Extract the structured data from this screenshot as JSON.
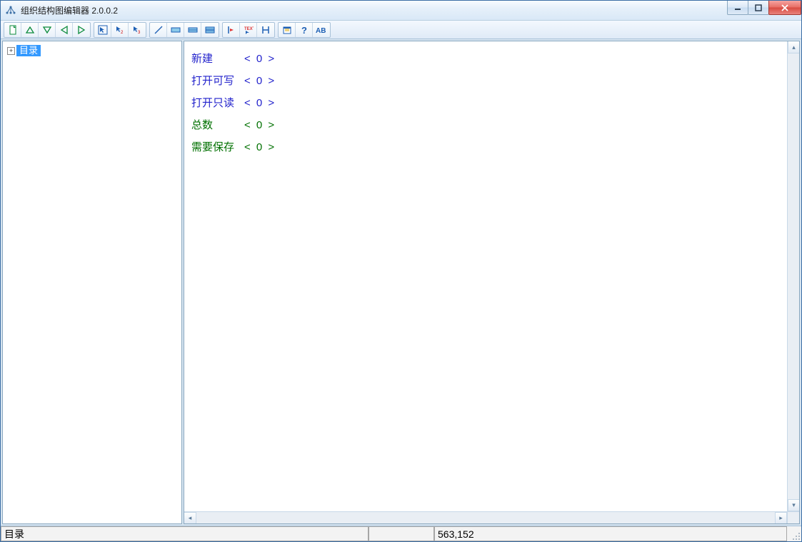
{
  "window": {
    "title": "组织结构图编辑器 2.0.0.2"
  },
  "tree": {
    "root_label": "目录"
  },
  "content": {
    "rows": [
      {
        "label": "新建",
        "value": "< 0 >",
        "cls": "blue"
      },
      {
        "label": "打开可写",
        "value": "< 0 >",
        "cls": "blue"
      },
      {
        "label": "打开只读",
        "value": "< 0 >",
        "cls": "blue"
      },
      {
        "label": "总数",
        "value": "< 0 >",
        "cls": "green"
      },
      {
        "label": "需要保存",
        "value": "< 0 >",
        "cls": "green"
      }
    ]
  },
  "status": {
    "left": "目录",
    "middle": "",
    "coords": "563,152"
  },
  "icons": {
    "new_doc": "new-doc",
    "up_tri": "up-triangle",
    "down_tri": "down-triangle",
    "left_tri": "left-triangle",
    "right_tri": "right-triangle",
    "cursor1": "cursor-1",
    "cursor2": "cursor-2",
    "cursor3": "cursor-3",
    "line": "line",
    "box1": "box-1",
    "box2": "box-2",
    "box3": "box-3",
    "hbar1": "hbar-1",
    "text": "text",
    "hh": "hh",
    "prop": "properties",
    "help": "help",
    "ab": "ab"
  }
}
